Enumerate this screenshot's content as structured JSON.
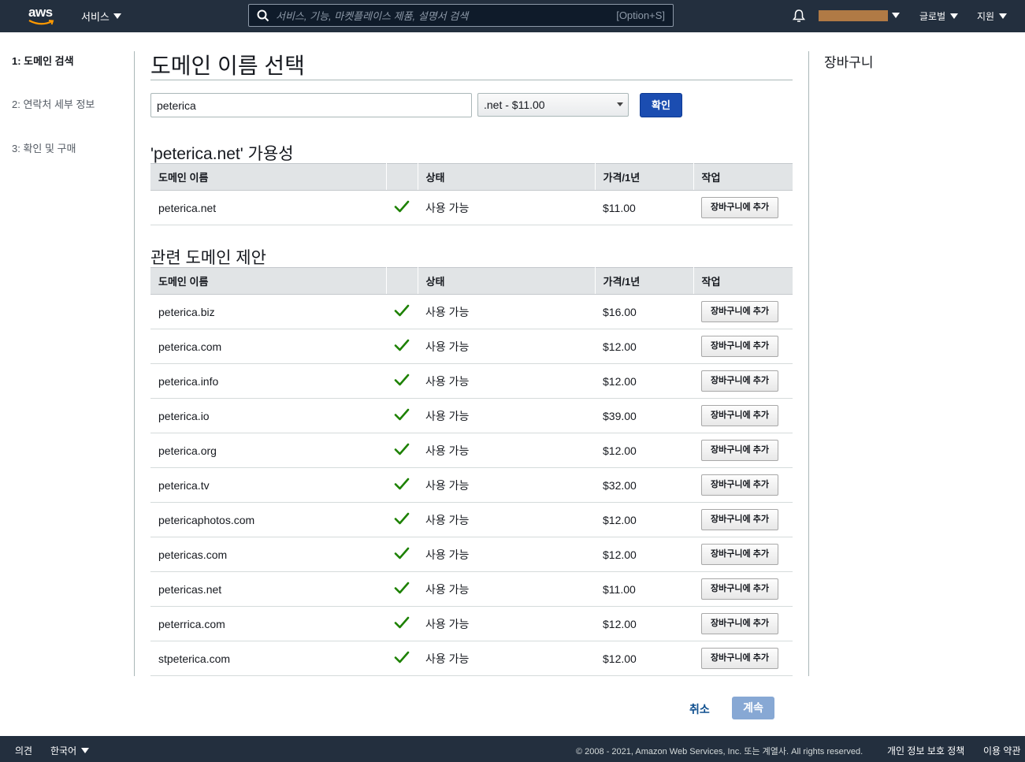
{
  "nav": {
    "logo": "aws",
    "services": "서비스",
    "search_placeholder": "서비스, 기능, 마켓플레이스 제품, 설명서 검색",
    "search_shortcut": "[Option+S]",
    "region": "글로벌",
    "support": "지원"
  },
  "steps": [
    {
      "label": "1: 도메인 검색",
      "active": true
    },
    {
      "label": "2: 연락처 세부 정보",
      "active": false
    },
    {
      "label": "3: 확인 및 구매",
      "active": false
    }
  ],
  "main": {
    "title": "도메인 이름 선택",
    "search_value": "peterica",
    "tld_selected": ".net - $11.00",
    "check_label": "확인",
    "availability_title": "'peterica.net' 가용성",
    "suggestions_title": "관련 도메인 제안",
    "columns": [
      "도메인 이름",
      "",
      "상태",
      "가격/1년",
      "작업"
    ],
    "availability_rows": [
      {
        "domain": "peterica.net",
        "status": "사용 가능",
        "price": "$11.00",
        "action": "장바구니에 추가"
      }
    ],
    "suggestion_rows": [
      {
        "domain": "peterica.biz",
        "status": "사용 가능",
        "price": "$16.00",
        "action": "장바구니에 추가"
      },
      {
        "domain": "peterica.com",
        "status": "사용 가능",
        "price": "$12.00",
        "action": "장바구니에 추가"
      },
      {
        "domain": "peterica.info",
        "status": "사용 가능",
        "price": "$12.00",
        "action": "장바구니에 추가"
      },
      {
        "domain": "peterica.io",
        "status": "사용 가능",
        "price": "$39.00",
        "action": "장바구니에 추가"
      },
      {
        "domain": "peterica.org",
        "status": "사용 가능",
        "price": "$12.00",
        "action": "장바구니에 추가"
      },
      {
        "domain": "peterica.tv",
        "status": "사용 가능",
        "price": "$32.00",
        "action": "장바구니에 추가"
      },
      {
        "domain": "petericaphotos.com",
        "status": "사용 가능",
        "price": "$12.00",
        "action": "장바구니에 추가"
      },
      {
        "domain": "petericas.com",
        "status": "사용 가능",
        "price": "$12.00",
        "action": "장바구니에 추가"
      },
      {
        "domain": "petericas.net",
        "status": "사용 가능",
        "price": "$11.00",
        "action": "장바구니에 추가"
      },
      {
        "domain": "peterrica.com",
        "status": "사용 가능",
        "price": "$12.00",
        "action": "장바구니에 추가"
      },
      {
        "domain": "stpeterica.com",
        "status": "사용 가능",
        "price": "$12.00",
        "action": "장바구니에 추가"
      }
    ],
    "cancel": "취소",
    "continue": "계속"
  },
  "cart": {
    "title": "장바구니"
  },
  "footer": {
    "feedback": "의견",
    "language": "한국어",
    "copyright": "© 2008 - 2021, Amazon Web Services, Inc. 또는 계열사. All rights reserved.",
    "privacy": "개인 정보 보호 정책",
    "terms": "이용 약관"
  },
  "colors": {
    "nav_bg": "#232f3e",
    "primary": "#1b4db1",
    "check": "#1d8102"
  }
}
